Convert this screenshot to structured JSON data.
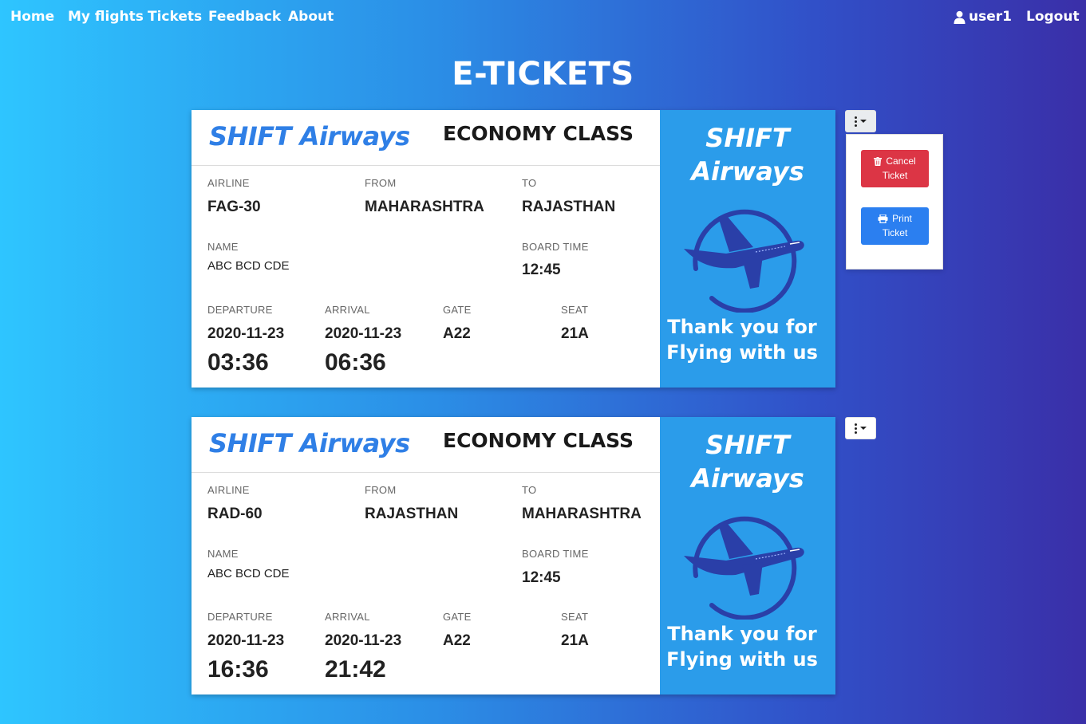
{
  "nav": {
    "links": [
      "Home",
      "My flights",
      "Tickets",
      "Feedback",
      "About"
    ],
    "user": "user1",
    "logout": "Logout"
  },
  "page_title": "E-TICKETS",
  "labels": {
    "airline": "AIRLINE",
    "from": "FROM",
    "to": "TO",
    "name": "NAME",
    "board_time": "BOARD TIME",
    "departure": "DEPARTURE",
    "arrival": "ARRIVAL",
    "gate": "GATE",
    "seat": "SEAT"
  },
  "side": {
    "brand_line1": "SHIFT",
    "brand_line2": "Airways",
    "thanks_line1": "Thank you for",
    "thanks_line2": "Flying with us"
  },
  "tickets": [
    {
      "brand": "SHIFT Airways",
      "class": "ECONOMY CLASS",
      "airline": "FAG-30",
      "from": "MAHARASHTRA",
      "to": "RAJASTHAN",
      "name": "ABC BCD CDE",
      "board_time": "12:45",
      "departure_date": "2020-11-23",
      "departure_time": "03:36",
      "arrival_date": "2020-11-23",
      "arrival_time": "06:36",
      "gate": "A22",
      "seat": "21A"
    },
    {
      "brand": "SHIFT Airways",
      "class": "ECONOMY CLASS",
      "airline": "RAD-60",
      "from": "RAJASTHAN",
      "to": "MAHARASHTRA",
      "name": "ABC BCD CDE",
      "board_time": "12:45",
      "departure_date": "2020-11-23",
      "departure_time": "16:36",
      "arrival_date": "2020-11-23",
      "arrival_time": "21:42",
      "gate": "A22",
      "seat": "21A"
    }
  ],
  "dropdown": {
    "cancel_line1": "Cancel",
    "cancel_line2": "Ticket",
    "print_line1": "Print",
    "print_line2": "Ticket"
  },
  "colors": {
    "cancel": "#dc3545",
    "print": "#2b7ff0",
    "brand": "#2f7fe6",
    "side_panel": "#2b9cea"
  }
}
